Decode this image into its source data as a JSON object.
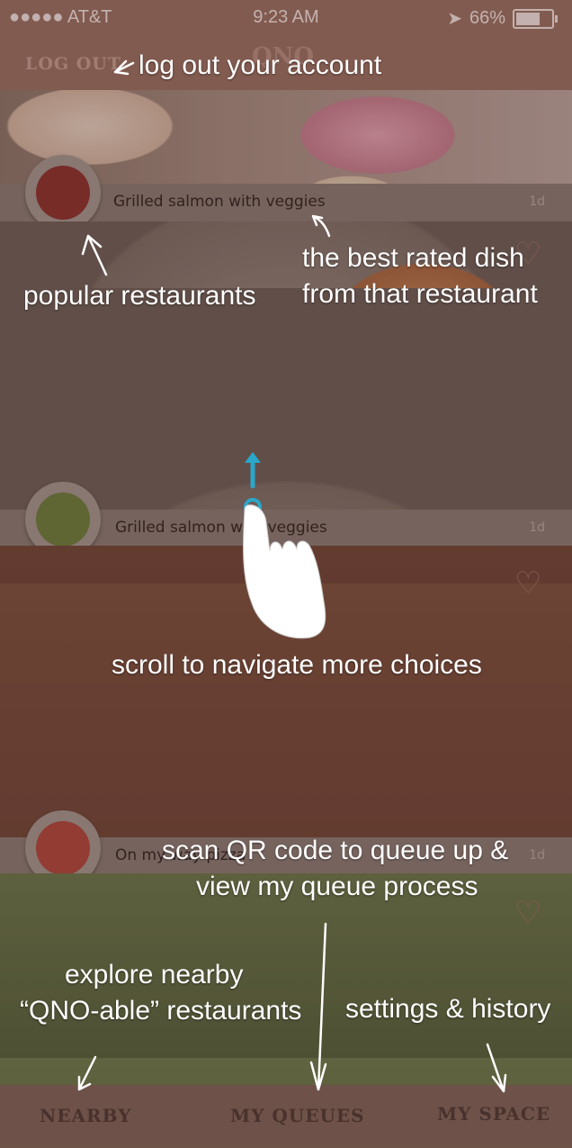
{
  "status_bar": {
    "carrier": "●●●●● AT&T",
    "time": "9:23 AM",
    "battery": "66%",
    "battery_level": 0.66
  },
  "header": {
    "logout_label": "LOG OUT",
    "logo_text": "QNO"
  },
  "feed": [
    {
      "title": "Grilled salmon with veggies",
      "age": "1d",
      "avatar_color": "#8b2f2a"
    },
    {
      "title": "Grilled salmon with veggies",
      "age": "1d",
      "avatar_color": "#6a7d3a"
    },
    {
      "title": "On my way pizza",
      "age": "1d",
      "avatar_color": "#b0443a"
    }
  ],
  "tabs": [
    {
      "label": "NEARBY"
    },
    {
      "label": "MY QUEUES"
    },
    {
      "label": "MY SPACE"
    }
  ],
  "hints": {
    "logout": "log out your account",
    "popular": "popular restaurants",
    "best_dish_line1": "the best rated dish",
    "best_dish_line2": "from that restaurant",
    "scroll": "scroll to navigate more choices",
    "scan_line1": "scan QR code to queue up &",
    "scan_line2": "view my queue process",
    "explore_line1": "explore nearby",
    "explore_line2": "“QNO-able” restaurants",
    "settings": "settings & history"
  },
  "colors": {
    "overlay_tint": "#5a3a33",
    "header": "#9a6f62",
    "hint_text": "#ffffff",
    "scroll_accent": "#2aa7c9"
  }
}
